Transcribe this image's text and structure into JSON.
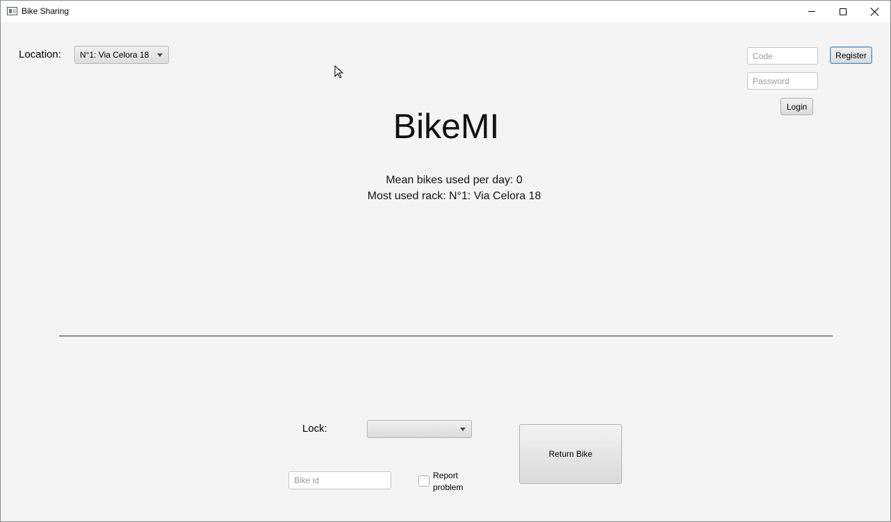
{
  "window": {
    "title": "Bike Sharing",
    "controls": {
      "minimize": "minimize-icon",
      "maximize": "maximize-icon",
      "close": "close-icon"
    }
  },
  "location": {
    "label": "Location:",
    "selected": "N°1: Via Celora 18"
  },
  "auth": {
    "code_placeholder": "Code",
    "password_placeholder": "Password",
    "register_label": "Register",
    "login_label": "Login"
  },
  "header": {
    "app_name": "BikeMI",
    "mean_bikes": "Mean bikes used per day: 0",
    "most_used_rack": "Most used rack: N°1: Via Celora 18"
  },
  "return_panel": {
    "lock_label": "Lock:",
    "lock_selected": "",
    "bike_id_placeholder": "Bike id",
    "report_line1": "Report",
    "report_line2": "problem",
    "report_checked": false,
    "return_label": "Return Bike"
  },
  "colors": {
    "background": "#f4f4f4",
    "focus_accent": "#3c8fd0"
  }
}
